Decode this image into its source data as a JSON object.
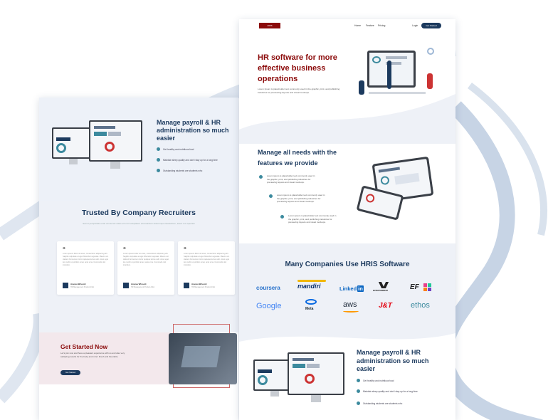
{
  "left_mockup": {
    "hero": {
      "title": "Manage payroll & HR administration so much easier",
      "features": [
        "Get healthy and nutritious food",
        "Maintain sleep quality and don't stay up for a long time",
        "Outstanding students are students who"
      ]
    },
    "trusted": {
      "title": "Trusted By Company Recruiters",
      "subtitle": "Sed ut perspiciatis unde omnis iste natus error sit voluptatem accusantium doloremque laudantium, totam rem aperiam",
      "testimonials": [
        {
          "quote_mark": "“",
          "text": "Lorem ipsum dolor sit amet, consectetur adipiscing elit. Sagittis vulputate at eget bibendum egestas. Mauris vel. Habent fermentum tortor quisque lectus velit. Amet eget leo morbi ut porttitor amet, ante urna. Commodo nisl interdum.",
          "name": "Aneisa Wlssott",
          "role": "HR Management Product Artist"
        },
        {
          "quote_mark": "“",
          "text": "Lorem ipsum dolor sit amet, consectetur adipiscing elit. Sagittis vulputate at eget bibendum egestas. Mauris vel. Habent fermentum tortor quisque lectus velit. Amet eget leo morbi ut porttitor amet, ante urna. Commodo nisl interdum.",
          "name": "Aneisa Wlssott",
          "role": "HR Management Product Artist"
        },
        {
          "quote_mark": "“",
          "text": "Lorem ipsum dolor sit amet, consectetur adipiscing elit. Sagittis vulputate at eget bibendum egestas. Mauris vel. Habent fermentum tortor quisque lectus velit. Amet eget leo morbi ut porttitor amet, ante urna. Commodo nisl interdum.",
          "name": "Aneisa Wlssott",
          "role": "HR Management Product Artist"
        }
      ]
    },
    "get_started": {
      "title": "Get Started Now",
      "text": "Let's join now and have a pleasant experience with us and also very satisfying results for the body and mind. Fresh and favorable.",
      "button": "Get Started"
    }
  },
  "right_mockup": {
    "nav": {
      "logo": "HRIS",
      "links": [
        "Home",
        "Feature",
        "Pricing"
      ],
      "login": "Login",
      "cta": "Get Started"
    },
    "hero": {
      "title": "HR software for more effective business operations",
      "text": "Lorem Ipsum is placeholder text commonly used in the graphic, print, and publishing industries for previewing layouts and visual mockups."
    },
    "features": {
      "title": "Manage all needs with the features we provide",
      "items": [
        "Lorem ipsum is placeholder text commonly used in the graphic, print, and publishing industries for previewing layouts and visual mockups.",
        "Lorem ipsum is placeholder text commonly used in the graphic, print, and publishing industries for previewing layouts and visual mockups.",
        "Lorem ipsum is placeholder text commonly used in the graphic, print, and publishing industries for previewing layouts and visual mockups."
      ]
    },
    "companies": {
      "title": "Many Companies Use HRIS Software",
      "logos": [
        "coursera",
        "mandiri",
        "Linked",
        "in",
        "ENTERTAINMENT",
        "EF",
        "Google",
        "Meta",
        "aws",
        "J&T",
        "ethos"
      ]
    },
    "payroll": {
      "title": "Manage payroll & HR administration so much easier",
      "features": [
        "Get healthy and nutritious food",
        "Maintain sleep quality and don't stay up for a long time",
        "Outstanding students are students who"
      ]
    }
  },
  "colors": {
    "brand_red": "#8b0a0a",
    "navy": "#1c3a5e",
    "teal": "#3c8a9e",
    "bg_curve": "#b9c9de"
  }
}
